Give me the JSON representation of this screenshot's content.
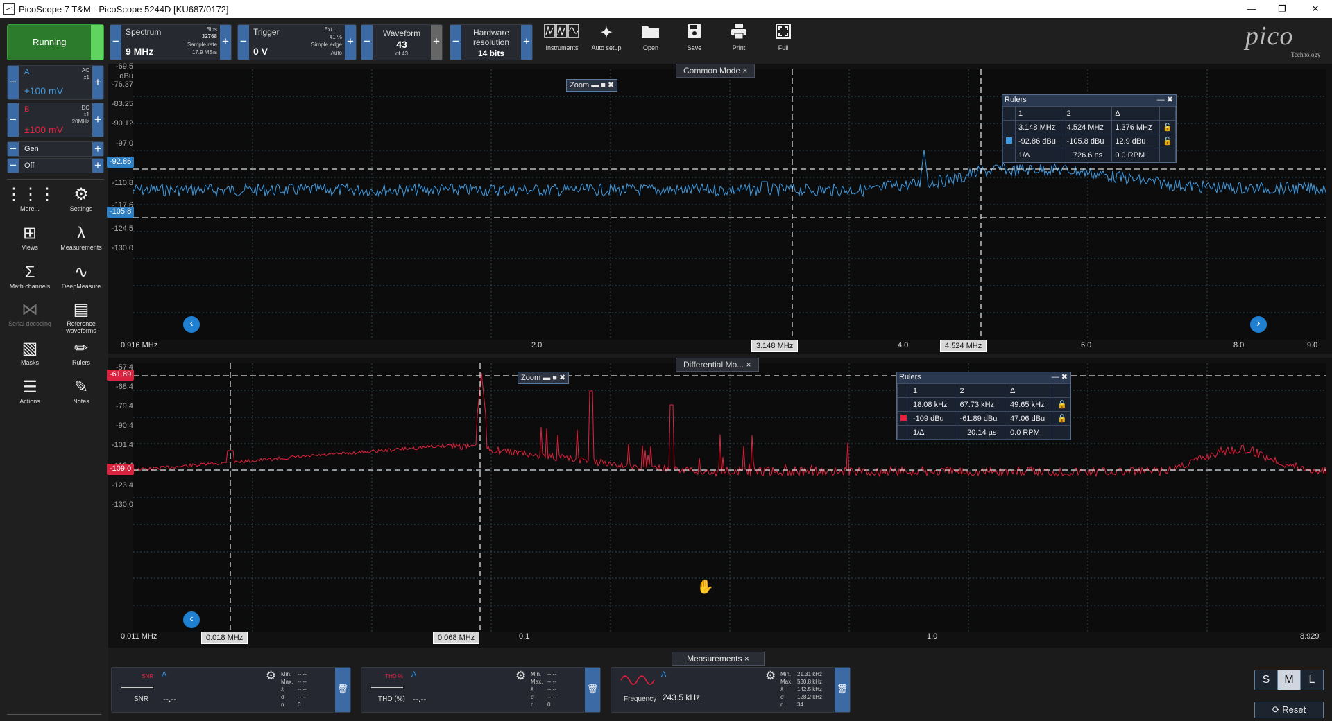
{
  "window": {
    "app": "PicoScope 7 T&M",
    "device": "PicoScope 5244D [KU687/0172]",
    "title": "PicoScope 7 T&M  - PicoScope 5244D [KU687/0172]"
  },
  "toolbar": {
    "run_label": "Running",
    "spectrum": {
      "label": "Spectrum",
      "value": "9 MHz",
      "bins_label": "Bins",
      "bins": "32768",
      "sample_rate_label": "Sample rate",
      "sample_rate": "17.9 MS/s"
    },
    "trigger": {
      "label": "Trigger",
      "value": "0 V",
      "ext": "Ext",
      "percent": "41 %",
      "type": "Simple edge",
      "mode": "Auto"
    },
    "waveform": {
      "label": "Waveform",
      "value": "43",
      "of": "of 43"
    },
    "hardware": {
      "label1": "Hardware",
      "label2": "resolution",
      "value": "14 bits"
    },
    "buttons": [
      {
        "label": "Instruments",
        "icon": "instruments-icon"
      },
      {
        "label": "Auto setup",
        "icon": "auto-setup-icon"
      },
      {
        "label": "Open",
        "icon": "folder-icon"
      },
      {
        "label": "Save",
        "icon": "save-icon"
      },
      {
        "label": "Print",
        "icon": "print-icon"
      },
      {
        "label": "Full",
        "icon": "fullscreen-icon"
      }
    ],
    "logo": "pico",
    "logo_sub": "Technology"
  },
  "channels": {
    "a": {
      "name": "A",
      "coupling": "AC",
      "probe": "x1",
      "range": "±100 mV"
    },
    "b": {
      "name": "B",
      "coupling": "DC",
      "probe": "x1",
      "bw": "20MHz",
      "range": "±100 mV"
    },
    "gen": "Gen",
    "off": "Off"
  },
  "sidebar": [
    {
      "label": "More...",
      "icon": "more-icon"
    },
    {
      "label": "Settings",
      "icon": "gear-icon"
    },
    {
      "label": "Views",
      "icon": "views-icon"
    },
    {
      "label": "Measurements",
      "icon": "measurements-icon"
    },
    {
      "label": "Math channels",
      "icon": "sigma-icon"
    },
    {
      "label": "DeepMeasure",
      "icon": "deepmeasure-icon"
    },
    {
      "label": "Serial decoding",
      "icon": "serial-decoding-icon"
    },
    {
      "label": "Reference waveforms",
      "icon": "reference-waveforms-icon"
    },
    {
      "label": "Masks",
      "icon": "masks-icon"
    },
    {
      "label": "Rulers",
      "icon": "rulers-icon"
    },
    {
      "label": "Actions",
      "icon": "actions-icon"
    },
    {
      "label": "Notes",
      "icon": "notes-icon"
    }
  ],
  "view1": {
    "title": "Common Mode",
    "zoom_label": "Zoom",
    "y_labels": [
      "-69.5",
      "dBu",
      "-76.37",
      "-83.25",
      "-90.12",
      "-97.0",
      "-103.9",
      "-110.8",
      "-117.6",
      "-124.5",
      "-130.0"
    ],
    "x_labels": [
      "0.916 MHz",
      "2.0",
      "4.0",
      "6.0",
      "8.0",
      "9.0"
    ],
    "ruler_y1_tag": "-92.86",
    "ruler_y2_tag": "-105.8",
    "ruler_x1_tag": "3.148 MHz",
    "ruler_x2_tag": "4.524 MHz",
    "rulers": {
      "title": "Rulers",
      "head": [
        "1",
        "2",
        "Δ"
      ],
      "x_row": [
        "3.148 MHz",
        "4.524 MHz",
        "1.376 MHz"
      ],
      "y_row": [
        "-92.86 dBu",
        "-105.8 dBu",
        "12.9 dBu"
      ],
      "inv_label": "1/Δ",
      "inv": [
        "726.6 ns",
        "0.0 RPM"
      ]
    },
    "color": "#3e9de6"
  },
  "view2": {
    "title": "Differential Mo...",
    "zoom_label": "Zoom",
    "y_labels": [
      "-57.4",
      "-68.4",
      "-79.4",
      "-90.4",
      "-101.4",
      "-112.4",
      "-123.4",
      "-130.0"
    ],
    "x_labels": [
      "0.011 MHz",
      "0.1",
      "1.0",
      "8.929"
    ],
    "ruler_y1_tag": "-61.89",
    "ruler_y2_tag": "-109.0",
    "ruler_x1_tag": "0.018 MHz",
    "ruler_x2_tag": "0.068 MHz",
    "rulers": {
      "title": "Rulers",
      "head": [
        "1",
        "2",
        "Δ"
      ],
      "x_row": [
        "18.08 kHz",
        "67.73 kHz",
        "49.65 kHz"
      ],
      "y_row": [
        "-109 dBu",
        "-61.89 dBu",
        "47.06 dBu"
      ],
      "inv_label": "1/Δ",
      "inv": [
        "20.14 µs",
        "0.0 RPM"
      ]
    },
    "color": "#e8203e"
  },
  "measurements": {
    "title": "Measurements",
    "items": [
      {
        "name": "SNR",
        "channel": "A",
        "value": "--.--",
        "icon_text": "SNR",
        "stat_labels": [
          "Min.",
          "Max.",
          "x̄",
          "σ",
          "n"
        ],
        "stat_values": [
          "--.--",
          "--.--",
          "--.--",
          "--.--",
          "0"
        ]
      },
      {
        "name": "THD (%)",
        "channel": "A",
        "value": "--.--",
        "icon_text": "THD %",
        "stat_labels": [
          "Min.",
          "Max.",
          "x̄",
          "σ",
          "n"
        ],
        "stat_values": [
          "--.--",
          "--.--",
          "--.--",
          "--.--",
          "0"
        ]
      },
      {
        "name": "Frequency",
        "channel": "A",
        "value": "243.5 kHz",
        "icon_text": "",
        "stat_labels": [
          "Min.",
          "Max.",
          "x̄",
          "σ",
          "n"
        ],
        "stat_values": [
          "21.31 kHz",
          "530.8 kHz",
          "142.5 kHz",
          "128.2 kHz",
          "34"
        ]
      }
    ],
    "size_buttons": [
      "S",
      "M",
      "L"
    ],
    "reset_label": "Reset"
  }
}
